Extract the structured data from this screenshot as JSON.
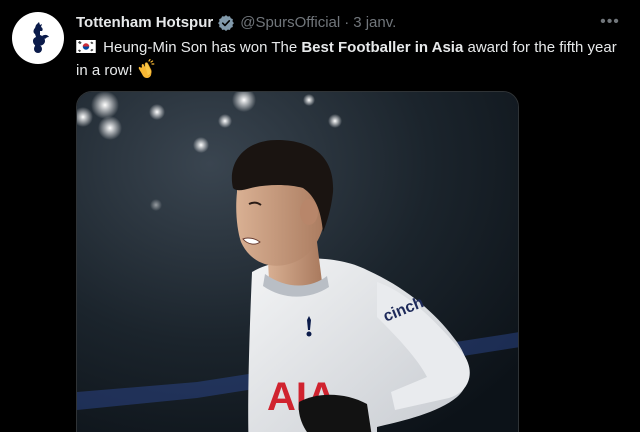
{
  "author": {
    "display_name": "Tottenham Hotspur",
    "handle": "@SpursOfficial",
    "separator": "·",
    "date": "3 janv.",
    "verified_icon": "verified-badge-icon",
    "avatar_icon": "spurs-cockerel-crest-icon"
  },
  "tweet": {
    "text_before": " Heung-Min Son has won The ",
    "text_bold": "Best Footballer in Asia",
    "text_after": " award for the fifth year in a row!",
    "leading_icon": "south-korea-flag-icon",
    "trailing_icon": "clapping-hands-icon"
  },
  "menu": {
    "more_label": "•••"
  },
  "media": {
    "shirt_sponsor": "AIA",
    "sleeve_text": "cinch"
  },
  "colors": {
    "background": "#000000",
    "text_primary": "#e7e9ea",
    "text_secondary": "#71767b",
    "verified": "#829aab",
    "sponsor_red": "#d0232f"
  }
}
